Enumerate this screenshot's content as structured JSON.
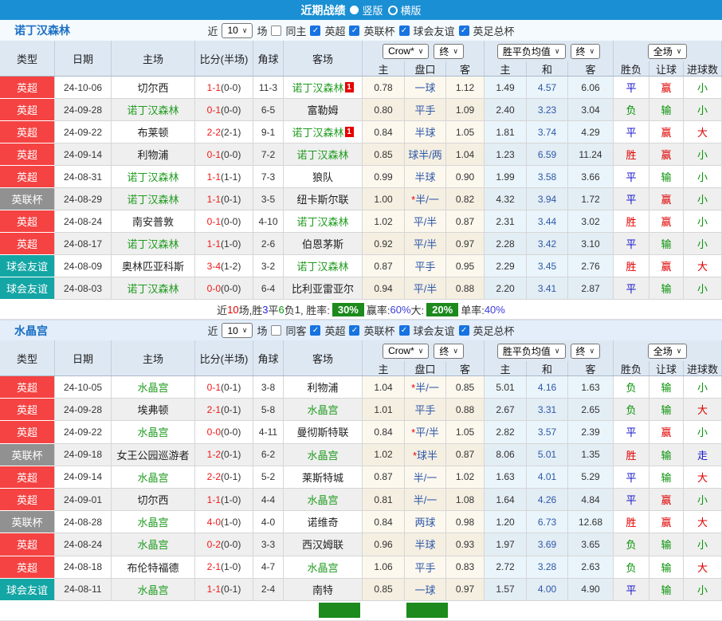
{
  "header": {
    "title": "近期战绩",
    "radios": [
      {
        "label": "竖版",
        "selected": true
      },
      {
        "label": "横版",
        "selected": false
      }
    ]
  },
  "filter": {
    "recent_label": "近",
    "matches_label": "场"
  },
  "table_header": {
    "left_cols": [
      "类型",
      "日期",
      "主场",
      "比分(半场)",
      "角球",
      "客场"
    ],
    "odds_company_select": "Crow*",
    "odds_stage_select": "终",
    "avg_select": "胜平负均值",
    "avg_stage_select": "终",
    "scope_select": "全场",
    "sub_cols": [
      "主",
      "盘口",
      "客",
      "主",
      "和",
      "客",
      "胜负",
      "让球",
      "进球数"
    ]
  },
  "colors": {
    "topbar": "#1a8fd4",
    "league_premier": "#f54242",
    "league_cup": "#919191",
    "league_friendly": "#14a5a5",
    "self_team": "#1f9b1f",
    "score": "#f01818",
    "handicap": "#2d58a8",
    "win": "#e00000",
    "draw": "#1515cc",
    "lose": "#089308",
    "rate_badge": "#1c8a1c"
  },
  "sections": [
    {
      "team": "诺丁汉森林",
      "count": "10",
      "same_label": "同主",
      "leagues": [
        "英超",
        "英联杯",
        "球会友谊",
        "英足总杯"
      ],
      "rows": [
        {
          "lg": "英超",
          "lgc": "red",
          "date": "24-10-06",
          "home": "切尔西",
          "hs": false,
          "hb": "",
          "score": "1-1",
          "half": "(0-0)",
          "cor": "11-3",
          "away": "诺丁汉森林",
          "as": true,
          "ab": "1",
          "o1": "0.78",
          "hd": "一球",
          "o2": "1.12",
          "a1": "1.49",
          "a2": "4.57",
          "a3": "6.06",
          "r1": "平",
          "c1": "b",
          "r2": "赢",
          "c2": "r",
          "r3": "小",
          "c3": "g"
        },
        {
          "lg": "英超",
          "lgc": "red",
          "date": "24-09-28",
          "home": "诺丁汉森林",
          "hs": true,
          "hb": "",
          "score": "0-1",
          "half": "(0-0)",
          "cor": "6-5",
          "away": "富勒姆",
          "as": false,
          "ab": "",
          "o1": "0.80",
          "hd": "平手",
          "o2": "1.09",
          "a1": "2.40",
          "a2": "3.23",
          "a3": "3.04",
          "r1": "负",
          "c1": "g",
          "r2": "输",
          "c2": "g",
          "r3": "小",
          "c3": "g"
        },
        {
          "lg": "英超",
          "lgc": "red",
          "date": "24-09-22",
          "home": "布莱顿",
          "hs": false,
          "hb": "",
          "score": "2-2",
          "half": "(2-1)",
          "cor": "9-1",
          "away": "诺丁汉森林",
          "as": true,
          "ab": "1",
          "o1": "0.84",
          "hd": "半球",
          "o2": "1.05",
          "a1": "1.81",
          "a2": "3.74",
          "a3": "4.29",
          "r1": "平",
          "c1": "b",
          "r2": "赢",
          "c2": "r",
          "r3": "大",
          "c3": "r"
        },
        {
          "lg": "英超",
          "lgc": "red",
          "date": "24-09-14",
          "home": "利物浦",
          "hs": false,
          "hb": "",
          "score": "0-1",
          "half": "(0-0)",
          "cor": "7-2",
          "away": "诺丁汉森林",
          "as": true,
          "ab": "",
          "o1": "0.85",
          "hd": "球半/两",
          "o2": "1.04",
          "a1": "1.23",
          "a2": "6.59",
          "a3": "11.24",
          "r1": "胜",
          "c1": "r",
          "r2": "赢",
          "c2": "r",
          "r3": "小",
          "c3": "g"
        },
        {
          "lg": "英超",
          "lgc": "red",
          "date": "24-08-31",
          "home": "诺丁汉森林",
          "hs": true,
          "hb": "",
          "score": "1-1",
          "half": "(1-1)",
          "cor": "7-3",
          "away": "狼队",
          "as": false,
          "ab": "",
          "o1": "0.99",
          "hd": "半球",
          "o2": "0.90",
          "a1": "1.99",
          "a2": "3.58",
          "a3": "3.66",
          "r1": "平",
          "c1": "b",
          "r2": "输",
          "c2": "g",
          "r3": "小",
          "c3": "g"
        },
        {
          "lg": "英联杯",
          "lgc": "gray",
          "date": "24-08-29",
          "home": "诺丁汉森林",
          "hs": true,
          "hb": "",
          "score": "1-1",
          "half": "(0-1)",
          "cor": "3-5",
          "away": "纽卡斯尔联",
          "as": false,
          "ab": "",
          "o1": "1.00",
          "hd": "*半/一",
          "o2": "0.82",
          "a1": "4.32",
          "a2": "3.94",
          "a3": "1.72",
          "r1": "平",
          "c1": "b",
          "r2": "赢",
          "c2": "r",
          "r3": "小",
          "c3": "g"
        },
        {
          "lg": "英超",
          "lgc": "red",
          "date": "24-08-24",
          "home": "南安普敦",
          "hs": false,
          "hb": "",
          "score": "0-1",
          "half": "(0-0)",
          "cor": "4-10",
          "away": "诺丁汉森林",
          "as": true,
          "ab": "",
          "o1": "1.02",
          "hd": "平/半",
          "o2": "0.87",
          "a1": "2.31",
          "a2": "3.44",
          "a3": "3.02",
          "r1": "胜",
          "c1": "r",
          "r2": "赢",
          "c2": "r",
          "r3": "小",
          "c3": "g"
        },
        {
          "lg": "英超",
          "lgc": "red",
          "date": "24-08-17",
          "home": "诺丁汉森林",
          "hs": true,
          "hb": "",
          "score": "1-1",
          "half": "(1-0)",
          "cor": "2-6",
          "away": "伯恩茅斯",
          "as": false,
          "ab": "",
          "o1": "0.92",
          "hd": "平/半",
          "o2": "0.97",
          "a1": "2.28",
          "a2": "3.42",
          "a3": "3.10",
          "r1": "平",
          "c1": "b",
          "r2": "输",
          "c2": "g",
          "r3": "小",
          "c3": "g"
        },
        {
          "lg": "球会友谊",
          "lgc": "teal",
          "date": "24-08-09",
          "home": "奥林匹亚科斯",
          "hs": false,
          "hb": "",
          "score": "3-4",
          "half": "(1-2)",
          "cor": "3-2",
          "away": "诺丁汉森林",
          "as": true,
          "ab": "",
          "o1": "0.87",
          "hd": "平手",
          "o2": "0.95",
          "a1": "2.29",
          "a2": "3.45",
          "a3": "2.76",
          "r1": "胜",
          "c1": "r",
          "r2": "赢",
          "c2": "r",
          "r3": "大",
          "c3": "r"
        },
        {
          "lg": "球会友谊",
          "lgc": "teal",
          "date": "24-08-03",
          "home": "诺丁汉森林",
          "hs": true,
          "hb": "",
          "score": "0-0",
          "half": "(0-0)",
          "cor": "6-4",
          "away": "比利亚雷亚尔",
          "as": false,
          "ab": "",
          "o1": "0.94",
          "hd": "平/半",
          "o2": "0.88",
          "a1": "2.20",
          "a2": "3.41",
          "a3": "2.87",
          "r1": "平",
          "c1": "b",
          "r2": "输",
          "c2": "g",
          "r3": "小",
          "c3": "g"
        }
      ],
      "summary": [
        {
          "t": "近",
          "s": "k"
        },
        {
          "t": "10",
          "s": "r"
        },
        {
          "t": "场,胜",
          "s": "k"
        },
        {
          "t": "3",
          "s": "b"
        },
        {
          "t": "平",
          "s": "k"
        },
        {
          "t": "6",
          "s": "g"
        },
        {
          "t": "负",
          "s": "k"
        },
        {
          "t": "1",
          "s": "k"
        },
        {
          "t": ", 胜率:",
          "s": "k"
        },
        {
          "t": "30%",
          "s": "badge"
        },
        {
          "t": " 赢率:",
          "s": "k"
        },
        {
          "t": "60%",
          "s": "p"
        },
        {
          "t": " 大:",
          "s": "k"
        },
        {
          "t": "20%",
          "s": "badge"
        },
        {
          "t": " 单率:",
          "s": "k"
        },
        {
          "t": "40%",
          "s": "p"
        }
      ],
      "summary_stub": false
    },
    {
      "team": "水晶宫",
      "count": "10",
      "same_label": "同客",
      "leagues": [
        "英超",
        "英联杯",
        "球会友谊",
        "英足总杯"
      ],
      "rows": [
        {
          "lg": "英超",
          "lgc": "red",
          "date": "24-10-05",
          "home": "水晶宫",
          "hs": true,
          "hb": "",
          "score": "0-1",
          "half": "(0-1)",
          "cor": "3-8",
          "away": "利物浦",
          "as": false,
          "ab": "",
          "o1": "1.04",
          "hd": "*半/一",
          "o2": "0.85",
          "a1": "5.01",
          "a2": "4.16",
          "a3": "1.63",
          "r1": "负",
          "c1": "g",
          "r2": "输",
          "c2": "g",
          "r3": "小",
          "c3": "g"
        },
        {
          "lg": "英超",
          "lgc": "red",
          "date": "24-09-28",
          "home": "埃弗顿",
          "hs": false,
          "hb": "",
          "score": "2-1",
          "half": "(0-1)",
          "cor": "5-8",
          "away": "水晶宫",
          "as": true,
          "ab": "",
          "o1": "1.01",
          "hd": "平手",
          "o2": "0.88",
          "a1": "2.67",
          "a2": "3.31",
          "a3": "2.65",
          "r1": "负",
          "c1": "g",
          "r2": "输",
          "c2": "g",
          "r3": "大",
          "c3": "r"
        },
        {
          "lg": "英超",
          "lgc": "red",
          "date": "24-09-22",
          "home": "水晶宫",
          "hs": true,
          "hb": "",
          "score": "0-0",
          "half": "(0-0)",
          "cor": "4-11",
          "away": "曼彻斯特联",
          "as": false,
          "ab": "",
          "o1": "0.84",
          "hd": "*平/半",
          "o2": "1.05",
          "a1": "2.82",
          "a2": "3.57",
          "a3": "2.39",
          "r1": "平",
          "c1": "b",
          "r2": "赢",
          "c2": "r",
          "r3": "小",
          "c3": "g"
        },
        {
          "lg": "英联杯",
          "lgc": "gray",
          "date": "24-09-18",
          "home": "女王公园巡游者",
          "hs": false,
          "hb": "",
          "score": "1-2",
          "half": "(0-1)",
          "cor": "6-2",
          "away": "水晶宫",
          "as": true,
          "ab": "",
          "o1": "1.02",
          "hd": "*球半",
          "o2": "0.87",
          "a1": "8.06",
          "a2": "5.01",
          "a3": "1.35",
          "r1": "胜",
          "c1": "r",
          "r2": "输",
          "c2": "g",
          "r3": "走",
          "c3": "b"
        },
        {
          "lg": "英超",
          "lgc": "red",
          "date": "24-09-14",
          "home": "水晶宫",
          "hs": true,
          "hb": "",
          "score": "2-2",
          "half": "(0-1)",
          "cor": "5-2",
          "away": "莱斯特城",
          "as": false,
          "ab": "",
          "o1": "0.87",
          "hd": "半/一",
          "o2": "1.02",
          "a1": "1.63",
          "a2": "4.01",
          "a3": "5.29",
          "r1": "平",
          "c1": "b",
          "r2": "输",
          "c2": "g",
          "r3": "大",
          "c3": "r"
        },
        {
          "lg": "英超",
          "lgc": "red",
          "date": "24-09-01",
          "home": "切尔西",
          "hs": false,
          "hb": "",
          "score": "1-1",
          "half": "(1-0)",
          "cor": "4-4",
          "away": "水晶宫",
          "as": true,
          "ab": "",
          "o1": "0.81",
          "hd": "半/一",
          "o2": "1.08",
          "a1": "1.64",
          "a2": "4.26",
          "a3": "4.84",
          "r1": "平",
          "c1": "b",
          "r2": "赢",
          "c2": "r",
          "r3": "小",
          "c3": "g"
        },
        {
          "lg": "英联杯",
          "lgc": "gray",
          "date": "24-08-28",
          "home": "水晶宫",
          "hs": true,
          "hb": "",
          "score": "4-0",
          "half": "(1-0)",
          "cor": "4-0",
          "away": "诺维奇",
          "as": false,
          "ab": "",
          "o1": "0.84",
          "hd": "两球",
          "o2": "0.98",
          "a1": "1.20",
          "a2": "6.73",
          "a3": "12.68",
          "r1": "胜",
          "c1": "r",
          "r2": "赢",
          "c2": "r",
          "r3": "大",
          "c3": "r"
        },
        {
          "lg": "英超",
          "lgc": "red",
          "date": "24-08-24",
          "home": "水晶宫",
          "hs": true,
          "hb": "",
          "score": "0-2",
          "half": "(0-0)",
          "cor": "3-3",
          "away": "西汉姆联",
          "as": false,
          "ab": "",
          "o1": "0.96",
          "hd": "半球",
          "o2": "0.93",
          "a1": "1.97",
          "a2": "3.69",
          "a3": "3.65",
          "r1": "负",
          "c1": "g",
          "r2": "输",
          "c2": "g",
          "r3": "小",
          "c3": "g"
        },
        {
          "lg": "英超",
          "lgc": "red",
          "date": "24-08-18",
          "home": "布伦特福德",
          "hs": false,
          "hb": "",
          "score": "2-1",
          "half": "(1-0)",
          "cor": "4-7",
          "away": "水晶宫",
          "as": true,
          "ab": "",
          "o1": "1.06",
          "hd": "平手",
          "o2": "0.83",
          "a1": "2.72",
          "a2": "3.28",
          "a3": "2.63",
          "r1": "负",
          "c1": "g",
          "r2": "输",
          "c2": "g",
          "r3": "大",
          "c3": "r"
        },
        {
          "lg": "球会友谊",
          "lgc": "teal",
          "date": "24-08-11",
          "home": "水晶宫",
          "hs": true,
          "hb": "",
          "score": "1-1",
          "half": "(0-1)",
          "cor": "2-4",
          "away": "南特",
          "as": false,
          "ab": "",
          "o1": "0.85",
          "hd": "一球",
          "o2": "0.97",
          "a1": "1.57",
          "a2": "4.00",
          "a3": "4.90",
          "r1": "平",
          "c1": "b",
          "r2": "输",
          "c2": "g",
          "r3": "小",
          "c3": "g"
        }
      ],
      "summary": null,
      "summary_stub": true
    }
  ]
}
